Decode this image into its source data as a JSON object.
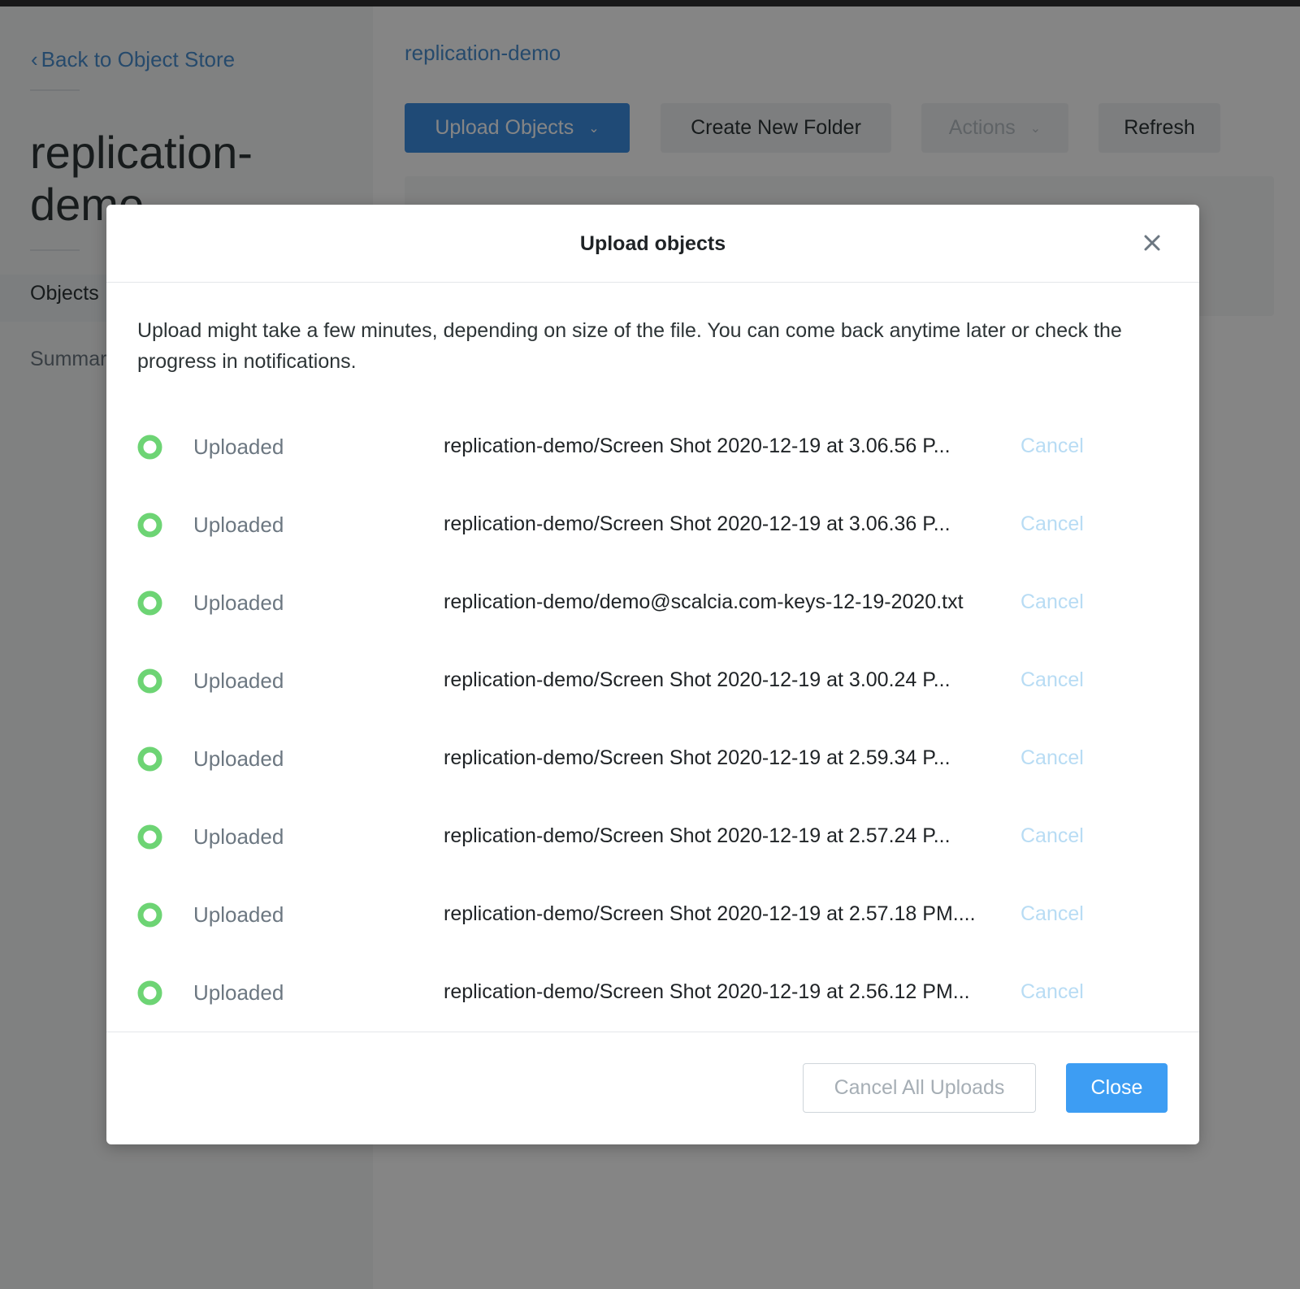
{
  "sidebar": {
    "back_link": "Back to Object Store",
    "bucket_title": "replication-demo",
    "nav": {
      "objects": "Objects",
      "summary": "Summary"
    }
  },
  "main": {
    "breadcrumb": "replication-demo",
    "toolbar": {
      "upload": "Upload Objects",
      "create_folder": "Create New Folder",
      "actions": "Actions",
      "refresh": "Refresh"
    }
  },
  "modal": {
    "title": "Upload objects",
    "description": "Upload might take a few minutes, depending on size of the file. You can come back anytime later or check the progress in notifications.",
    "rows": [
      {
        "status": "Uploaded",
        "file": "replication-demo/Screen Shot 2020-12-19 at 3.06.56 P...",
        "action": "Cancel"
      },
      {
        "status": "Uploaded",
        "file": "replication-demo/Screen Shot 2020-12-19 at 3.06.36 P...",
        "action": "Cancel"
      },
      {
        "status": "Uploaded",
        "file": "replication-demo/demo@scalcia.com-keys-12-19-2020.txt",
        "action": "Cancel"
      },
      {
        "status": "Uploaded",
        "file": "replication-demo/Screen Shot 2020-12-19 at 3.00.24 P...",
        "action": "Cancel"
      },
      {
        "status": "Uploaded",
        "file": "replication-demo/Screen Shot 2020-12-19 at 2.59.34 P...",
        "action": "Cancel"
      },
      {
        "status": "Uploaded",
        "file": "replication-demo/Screen Shot 2020-12-19 at 2.57.24 P...",
        "action": "Cancel"
      },
      {
        "status": "Uploaded",
        "file": "replication-demo/Screen Shot 2020-12-19 at 2.57.18 PM....",
        "action": "Cancel"
      },
      {
        "status": "Uploaded",
        "file": "replication-demo/Screen Shot 2020-12-19 at 2.56.12 PM...",
        "action": "Cancel"
      }
    ],
    "footer": {
      "cancel_all": "Cancel All Uploads",
      "close": "Close"
    }
  },
  "colors": {
    "accent": "#3d8ee3",
    "close_button": "#3d9df3",
    "status_success": "#6dd474",
    "cancel_link": "#b8dcf4"
  },
  "icons": {
    "back": "chevron-left-icon",
    "dropdown": "chevron-down-icon",
    "close": "close-icon",
    "status": "status-circle-icon"
  }
}
